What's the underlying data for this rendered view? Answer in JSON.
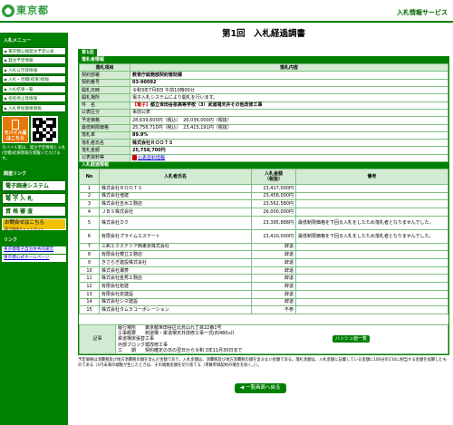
{
  "header": {
    "logo_text": "東京都",
    "service_name": "入札情報サービス"
  },
  "sidebar": {
    "menu_heading": "入札メニュー",
    "items": [
      "東京都公報発注予定公表",
      "発注予定情報",
      "入札公示等情報",
      "入札・見積(結果)情報",
      "入札結果一覧",
      "指名停止等情報",
      "入札参加資格情報"
    ],
    "mobile_label": "モバイル版はこちら",
    "mobile_note": "モバイル版は、発注予定情報と入札(見積)結果情報を閲覧いただけます。",
    "links_heading": "関連リンク",
    "big_items": [
      "電子調達システム(TOP)",
      "電 子 入 札",
      "資 格 審 査"
    ],
    "help_label": "お問合せはこちら",
    "help_sub": "電子調達チャットボット",
    "related_heading": "リンク",
    "related": [
      "東京都電子自治体共同運営",
      "東京都公式ホームページ"
    ]
  },
  "main": {
    "title": "第1回　入札経過調書",
    "tab": "第1回",
    "info_heading": "落札者情報",
    "info_col_item": "落札項目",
    "info_col_content": "落札内容",
    "info_rows": [
      {
        "k": "契約部署",
        "v": "教育庁総務部契約管財課",
        "bold": true
      },
      {
        "k": "契約番号",
        "v": "03-90092",
        "bold": true
      },
      {
        "k": "開札日時",
        "v": "令和3年7月8日 午前10時00分"
      },
      {
        "k": "開札場所",
        "v": "電子入札システムにより開札を行います。"
      },
      {
        "k": "件　名",
        "v": "都立世田谷泉高等学校（3）武道場天井その他改修工事",
        "bold": true,
        "tag": "【電子】"
      },
      {
        "k": "公表区分",
        "v": "事前公表"
      },
      {
        "k": "予定価格",
        "v": "28,639,600円（税込）　26,036,000円（税抜）"
      },
      {
        "k": "最低制限価格",
        "v": "25,756,710円（税込）　23,415,191円（税抜）"
      },
      {
        "k": "落札率",
        "v": "89.9%",
        "bold": true
      },
      {
        "k": "落札者氏名",
        "v": "株式会社ＲＯＯＴＳ",
        "bold": true
      },
      {
        "k": "落札金額",
        "v": "25,758,700円",
        "bold": true
      },
      {
        "k": "公表資料等",
        "v": "公表資料情報",
        "link": true
      }
    ],
    "bids_heading": "入札経過情報",
    "bids_cols": {
      "no": "No",
      "name": "入札者氏名",
      "amount": "入札金額\n（税抜）",
      "remark": "備考"
    },
    "bids": [
      {
        "no": "1",
        "name": "株式会社ＲＯＯＴＳ",
        "amount": "23,417,000円",
        "remark": ""
      },
      {
        "no": "2",
        "name": "株式会社増建",
        "amount": "23,458,000円",
        "remark": ""
      },
      {
        "no": "3",
        "name": "株式会社吉水工務店",
        "amount": "23,562,580円",
        "remark": ""
      },
      {
        "no": "4",
        "name": "ＪＢＳ株式会社",
        "amount": "26,000,000円",
        "remark": ""
      },
      {
        "no": "5",
        "name": "株式会社カク",
        "amount": "23,395,888円",
        "remark": "最低制限価格を下回る入札をしたため落札者となりませんでした。"
      },
      {
        "no": "6",
        "name": "有限会社プライムエステート",
        "amount": "23,410,000円",
        "remark": "最低制限価格を下回る入札をしたため落札者となりませんでした。"
      },
      {
        "no": "7",
        "name": "三和エクステリア西東京株式会社",
        "amount": "辞退",
        "remark": ""
      },
      {
        "no": "8",
        "name": "有限会社櫻立工務店",
        "amount": "辞退",
        "remark": ""
      },
      {
        "no": "9",
        "name": "きさらぎ建設株式会社",
        "amount": "辞退",
        "remark": ""
      },
      {
        "no": "10",
        "name": "株式会社瀬菱",
        "amount": "辞退",
        "remark": ""
      },
      {
        "no": "11",
        "name": "株式会社金秀工務店",
        "amount": "辞退",
        "remark": ""
      },
      {
        "no": "12",
        "name": "有限会社拓建",
        "amount": "辞退",
        "remark": ""
      },
      {
        "no": "13",
        "name": "有限会社泉建設",
        "amount": "辞退",
        "remark": ""
      },
      {
        "no": "14",
        "name": "株式会社シマ建設",
        "amount": "辞退",
        "remark": ""
      },
      {
        "no": "15",
        "name": "株式会社タムラコーポレーション",
        "amount": "不参",
        "remark": ""
      }
    ],
    "summary_btn": "ハッシュ値一覧",
    "notes_label": "記事",
    "notes": [
      "履行場所　　東京都世田谷区北烏山九丁目22番1号",
      "工事概要　　剣道場・柔道場天井改修工事一式(約480㎡)",
      "柔道場床張替工事",
      "外部ブロック塀改修工事",
      "工　　期　　契約確定の日の翌日から令和 3年11月30日まで"
    ],
    "footnote": "予定価格は消費税及び地方消費税の額を含んだ金額であり、入札金額は、消費税及び地方消費税の額を含まない金額である。落札金額は、入札金額に記載している金額に100分の110に相当する金額を加算したものである（1円未満の端数が生じたときは、その端数金額を切り捨てる（単数単価契約の場合を除く。））。",
    "back_btn": "一覧画面へ戻る"
  }
}
